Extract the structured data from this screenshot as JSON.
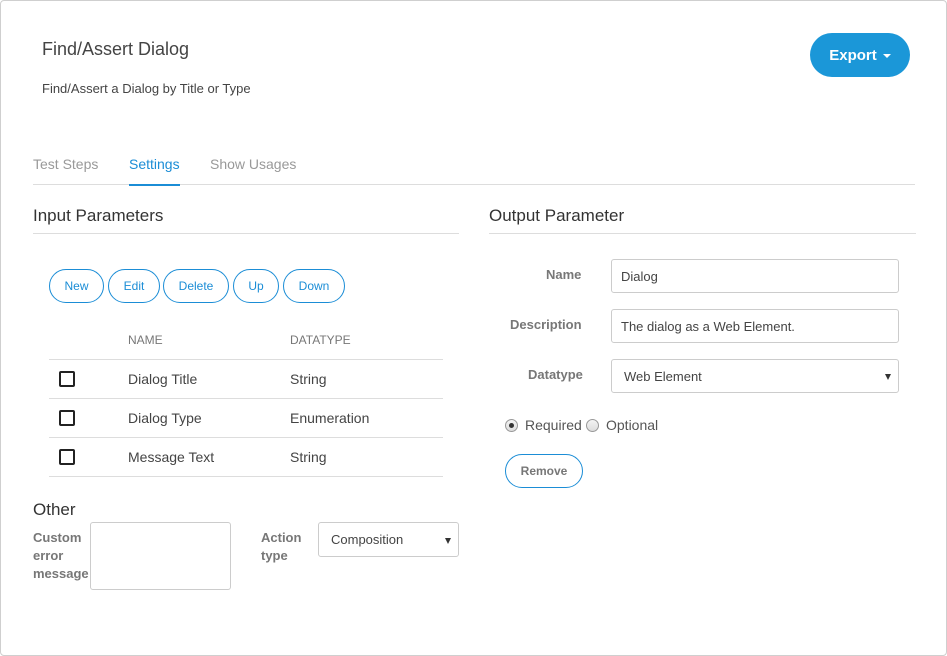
{
  "header": {
    "title": "Find/Assert Dialog",
    "subtitle": "Find/Assert a Dialog by Title or Type",
    "export_label": "Export"
  },
  "tabs": [
    {
      "label": "Test Steps",
      "active": false
    },
    {
      "label": "Settings",
      "active": true
    },
    {
      "label": "Show Usages",
      "active": false
    }
  ],
  "input_parameters": {
    "title": "Input Parameters",
    "buttons": {
      "new": "New",
      "edit": "Edit",
      "delete": "Delete",
      "up": "Up",
      "down": "Down"
    },
    "columns": {
      "name": "NAME",
      "datatype": "DATATYPE"
    },
    "rows": [
      {
        "name": "Dialog Title",
        "datatype": "String",
        "checked": false
      },
      {
        "name": "Dialog Type",
        "datatype": "Enumeration",
        "checked": false
      },
      {
        "name": "Message Text",
        "datatype": "String",
        "checked": false
      }
    ]
  },
  "other": {
    "title": "Other",
    "custom_error_label_line1": "Custom",
    "custom_error_label_line2": "error",
    "custom_error_label_line3": "message",
    "custom_error_value": "",
    "action_type_label_line1": "Action",
    "action_type_label_line2": "type",
    "action_type_value": "Composition"
  },
  "output_parameter": {
    "title": "Output Parameter",
    "name_label": "Name",
    "name_value": "Dialog",
    "description_label": "Description",
    "description_value": "The dialog as a Web Element.",
    "datatype_label": "Datatype",
    "datatype_value": "Web Element",
    "required_label": "Required",
    "optional_label": "Optional",
    "selected": "Required",
    "remove_label": "Remove"
  },
  "colors": {
    "accent": "#1b97d8",
    "link": "#1b8dd6",
    "border": "#dddddd"
  }
}
